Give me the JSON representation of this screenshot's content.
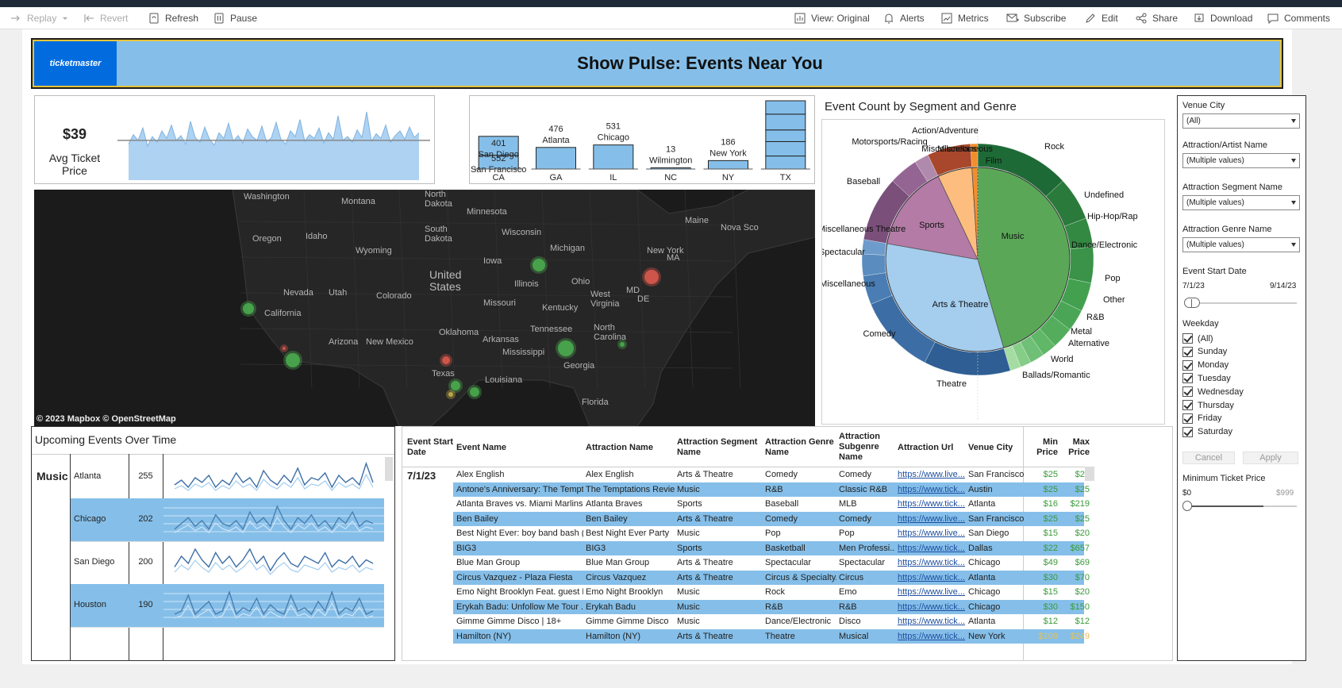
{
  "toolbar": {
    "replay": "Replay",
    "revert": "Revert",
    "refresh": "Refresh",
    "pause": "Pause",
    "view": "View: Original",
    "alerts": "Alerts",
    "metrics": "Metrics",
    "subscribe": "Subscribe",
    "edit": "Edit",
    "share": "Share",
    "download": "Download",
    "comments": "Comments"
  },
  "header": {
    "logo": "ticketmaster",
    "title": "Show Pulse: Events Near You"
  },
  "kpi": {
    "value": "$39",
    "label": "Avg Ticket Price"
  },
  "price_spark": [
    38,
    48,
    42,
    55,
    36,
    46,
    40,
    52,
    44,
    58,
    42,
    47,
    38,
    62,
    45,
    40,
    56,
    43,
    37,
    50,
    44,
    60,
    41,
    47,
    39,
    54,
    46,
    42,
    57,
    40,
    45,
    61,
    43,
    38,
    52,
    46,
    64,
    41,
    48,
    44,
    55,
    39,
    50,
    43,
    68,
    42,
    46,
    40,
    53,
    45,
    72,
    41,
    49,
    44,
    58,
    40,
    47,
    52,
    43,
    56,
    45,
    50
  ],
  "state_bars": {
    "states": [
      {
        "code": "CA",
        "labels": [
          {
            "value": "401",
            "city": "San Diego"
          },
          {
            "value": "552",
            "city": "San Francisco"
          }
        ],
        "segments": [
          401,
          552
        ]
      },
      {
        "code": "GA",
        "labels": [
          {
            "value": "476",
            "city": "Atlanta"
          }
        ],
        "segments": [
          476
        ]
      },
      {
        "code": "IL",
        "labels": [
          {
            "value": "531",
            "city": "Chicago"
          }
        ],
        "segments": [
          531
        ]
      },
      {
        "code": "NC",
        "labels": [
          {
            "value": "13",
            "city": "Wilmington"
          }
        ],
        "segments": [
          13
        ]
      },
      {
        "code": "NY",
        "labels": [
          {
            "value": "186",
            "city": "New York"
          }
        ],
        "segments": [
          186
        ]
      },
      {
        "code": "TX",
        "labels": [],
        "segments": [
          380,
          420,
          340,
          460,
          390
        ]
      }
    ]
  },
  "map": {
    "attribution": "© 2023 Mapbox  © OpenStreetMap",
    "labels": [
      "Washington",
      "Montana",
      "North Dakota",
      "Minnesota",
      "South Dakota",
      "Wisconsin",
      "Oregon",
      "Idaho",
      "Wyoming",
      "Michigan",
      "Maine",
      "Nova Sco",
      "New York",
      "MA",
      "Iowa",
      "United States",
      "Illinois",
      "Ohio",
      "Nevada",
      "Utah",
      "Colorado",
      "MD",
      "DE",
      "California",
      "Missouri",
      "West Virginia",
      "Kentucky",
      "Oklahoma",
      "North Carolina",
      "Tennessee",
      "Arizona",
      "New Mexico",
      "Arkansas",
      "Mississippi",
      "Georgia",
      "Texas",
      "Louisiana",
      "Florida"
    ]
  },
  "donut": {
    "title": "Event Count by Segment and Genre",
    "segments": [
      {
        "name": "Music",
        "value": 45,
        "color": "#5aa857"
      },
      {
        "name": "Arts & Theatre",
        "value": 32,
        "color": "#a4cdee"
      },
      {
        "name": "Sports",
        "value": 15,
        "color": "#b47ba6"
      },
      {
        "name": "Miscellaneous",
        "value": 6,
        "color": "#fdbd7e"
      },
      {
        "name": "Film",
        "value": 1,
        "color": "#f28e2b"
      }
    ],
    "genres": [
      {
        "name": "Rock",
        "value": 13,
        "color": "#1e6a36"
      },
      {
        "name": "Undefined",
        "value": 6,
        "color": "#2a7a3c"
      },
      {
        "name": "Hip-Hop/Rap",
        "value": 4,
        "color": "#338842"
      },
      {
        "name": "Dance/Electronic",
        "value": 5,
        "color": "#3a9348"
      },
      {
        "name": "Pop",
        "value": 4,
        "color": "#43a04f"
      },
      {
        "name": "Other",
        "value": 3,
        "color": "#4aa656"
      },
      {
        "name": "R&B",
        "value": 3,
        "color": "#53ad5d"
      },
      {
        "name": "Metal",
        "value": 2,
        "color": "#5fb767"
      },
      {
        "name": "Alternative",
        "value": 2,
        "color": "#6fc076"
      },
      {
        "name": "World",
        "value": 1.5,
        "color": "#86cd88"
      },
      {
        "name": "Ballads/Romantic",
        "value": 1.5,
        "color": "#a5dca4"
      },
      {
        "name": "Theatre",
        "value": 12,
        "color": "#2e5e93"
      },
      {
        "name": "Comedy",
        "value": 11,
        "color": "#3c6ea5"
      },
      {
        "name": "Miscellaneous",
        "value": 4,
        "color": "#4a7db3"
      },
      {
        "name": "Spectacular",
        "value": 3,
        "color": "#5a8cbf"
      },
      {
        "name": "Miscellaneous Theatre",
        "value": 2,
        "color": "#6d9bcb"
      },
      {
        "name": "Baseball",
        "value": 9,
        "color": "#7a4f7a"
      },
      {
        "name": "Motorsports/Racing",
        "value": 4,
        "color": "#946593"
      },
      {
        "name": "Other Sports",
        "value": 2,
        "color": "#b08aac"
      },
      {
        "name": "Miscellaneous",
        "value": 6,
        "color": "#a8472b"
      },
      {
        "name": "Action/Adventure",
        "value": 1,
        "color": "#f28e2b"
      }
    ]
  },
  "upcoming": {
    "title": "Upcoming Events Over Time",
    "segment": "Music",
    "rows": [
      {
        "city": "Atlanta",
        "count": "255",
        "series": [
          3,
          5,
          2,
          6,
          4,
          7,
          2,
          5,
          3,
          8,
          4,
          6,
          2,
          9,
          5,
          3,
          7,
          4,
          10,
          3,
          6,
          5,
          8,
          2,
          7,
          4,
          6,
          3,
          12,
          4
        ]
      },
      {
        "city": "Chicago",
        "count": "202",
        "series": [
          2,
          4,
          6,
          3,
          5,
          2,
          7,
          4,
          3,
          5,
          2,
          8,
          4,
          6,
          3,
          10,
          5,
          2,
          6,
          4,
          7,
          3,
          5,
          2,
          6,
          4,
          8,
          3,
          5,
          4
        ]
      },
      {
        "city": "San Diego",
        "count": "200",
        "series": [
          3,
          6,
          4,
          8,
          5,
          3,
          7,
          4,
          6,
          3,
          5,
          8,
          4,
          6,
          2,
          5,
          7,
          4,
          3,
          6,
          5,
          4,
          7,
          3,
          5,
          4,
          6,
          3,
          5,
          4
        ]
      },
      {
        "city": "Houston",
        "count": "190",
        "series": [
          2,
          3,
          8,
          2,
          4,
          6,
          2,
          3,
          9,
          2,
          4,
          3,
          7,
          2,
          5,
          3,
          2,
          8,
          3,
          4,
          2,
          6,
          3,
          9,
          2,
          4,
          3,
          7,
          2,
          3
        ]
      }
    ]
  },
  "events": {
    "headers": [
      "Event Start Date",
      "Event Name",
      "Attraction Name",
      "Attraction Segment Name",
      "Attraction Genre Name",
      "Attraction Subgenre Name",
      "Attraction Url",
      "Venue City",
      "Min Price",
      "Max Price"
    ],
    "date": "7/1/23",
    "rows": [
      {
        "event": "Alex English",
        "attraction": "Alex English",
        "segment": "Arts & Theatre",
        "genre": "Comedy",
        "subgenre": "Comedy",
        "url": "https://www.live...",
        "city": "San Francisco",
        "min": "$25",
        "max": "$25"
      },
      {
        "event": "Antone's Anniversary: The Tempt..",
        "attraction": "The Temptations Revie..",
        "segment": "Music",
        "genre": "R&B",
        "subgenre": "Classic R&B",
        "url": "https://www.tick...",
        "city": "Austin",
        "min": "$25",
        "max": "$25"
      },
      {
        "event": "Atlanta Braves vs. Miami Marlins",
        "attraction": "Atlanta Braves",
        "segment": "Sports",
        "genre": "Baseball",
        "subgenre": "MLB",
        "url": "https://www.tick...",
        "city": "Atlanta",
        "min": "$16",
        "max": "$219"
      },
      {
        "event": "Ben Bailey",
        "attraction": "Ben Bailey",
        "segment": "Arts & Theatre",
        "genre": "Comedy",
        "subgenre": "Comedy",
        "url": "https://www.live...",
        "city": "San Francisco",
        "min": "$25",
        "max": "$25"
      },
      {
        "event": "Best Night Ever: boy band bash (1..",
        "attraction": "Best Night Ever Party",
        "segment": "Music",
        "genre": "Pop",
        "subgenre": "Pop",
        "url": "https://www.live...",
        "city": "San Diego",
        "min": "$15",
        "max": "$20"
      },
      {
        "event": "BIG3",
        "attraction": "BIG3",
        "segment": "Sports",
        "genre": "Basketball",
        "subgenre": "Men Professi..",
        "url": "https://www.tick...",
        "city": "Dallas",
        "min": "$22",
        "max": "$657"
      },
      {
        "event": "Blue Man Group",
        "attraction": "Blue Man Group",
        "segment": "Arts & Theatre",
        "genre": "Spectacular",
        "subgenre": "Spectacular",
        "url": "https://www.tick...",
        "city": "Chicago",
        "min": "$49",
        "max": "$69"
      },
      {
        "event": "Circus Vazquez - Plaza Fiesta",
        "attraction": "Circus Vazquez",
        "segment": "Arts & Theatre",
        "genre": "Circus & Specialty..",
        "subgenre": "Circus",
        "url": "https://www.tick...",
        "city": "Atlanta",
        "min": "$30",
        "max": "$70"
      },
      {
        "event": "Emo Night Brooklyn Feat. guest D..",
        "attraction": "Emo Night Brooklyn",
        "segment": "Music",
        "genre": "Rock",
        "subgenre": "Emo",
        "url": "https://www.live...",
        "city": "Chicago",
        "min": "$15",
        "max": "$20"
      },
      {
        "event": "Erykah Badu: Unfollow Me Tour ..",
        "attraction": "Erykah Badu",
        "segment": "Music",
        "genre": "R&B",
        "subgenre": "R&B",
        "url": "https://www.tick...",
        "city": "Chicago",
        "min": "$30",
        "max": "$150"
      },
      {
        "event": "Gimme Gimme Disco | 18+",
        "attraction": "Gimme Gimme Disco",
        "segment": "Music",
        "genre": "Dance/Electronic",
        "subgenre": "Disco",
        "url": "https://www.tick...",
        "city": "Atlanta",
        "min": "$12",
        "max": "$12"
      },
      {
        "event": "Hamilton (NY)",
        "attraction": "Hamilton (NY)",
        "segment": "Arts & Theatre",
        "genre": "Theatre",
        "subgenre": "Musical",
        "url": "https://www.tick...",
        "city": "New York",
        "min": "$109",
        "max": "$249"
      }
    ]
  },
  "filters": {
    "venue_city": {
      "label": "Venue City",
      "value": "(All)"
    },
    "artist": {
      "label": "Attraction/Artist Name",
      "value": "(Multiple values)"
    },
    "segment": {
      "label": "Attraction Segment Name",
      "value": "(Multiple values)"
    },
    "genre": {
      "label": "Attraction Genre Name",
      "value": "(Multiple values)"
    },
    "date": {
      "label": "Event Start Date",
      "start": "7/1/23",
      "end": "9/14/23"
    },
    "weekday": {
      "label": "Weekday",
      "options": [
        "(All)",
        "Sunday",
        "Monday",
        "Tuesday",
        "Wednesday",
        "Thursday",
        "Friday",
        "Saturday"
      ]
    },
    "cancel": "Cancel",
    "apply": "Apply",
    "min_price": {
      "label": "Minimum Ticket Price",
      "min": "$0",
      "max": "$999"
    }
  },
  "colors": {
    "header_bg": "#85bfe9",
    "accent_blue": "#026cdf",
    "row_highlight": "#85bfe9",
    "price_green": "#3a9a3a",
    "map_bg": "#1b1b1b"
  }
}
